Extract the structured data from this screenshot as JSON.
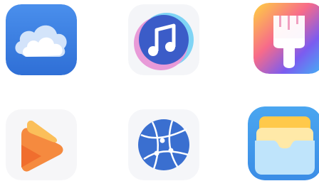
{
  "apps": [
    {
      "id": "cloud",
      "icon": "cloud-icon"
    },
    {
      "id": "music",
      "icon": "music-note-icon"
    },
    {
      "id": "themes",
      "icon": "paintbrush-icon"
    },
    {
      "id": "video",
      "icon": "play-icon"
    },
    {
      "id": "browser",
      "icon": "globe-icon"
    },
    {
      "id": "wallet",
      "icon": "wallet-icon"
    }
  ],
  "colors": {
    "cloud_bg": "#3a7fe0",
    "music_bg": "#3b5cc8",
    "theme_gradient": [
      "#ffd23f",
      "#f76b8a",
      "#7b5cf0",
      "#3fb7f5"
    ],
    "video_orange": "#f5823a",
    "browser_blue": "#3a6fd0",
    "wallet_blue": "#4aa6f0",
    "wallet_yellow": "#ffc94a"
  }
}
